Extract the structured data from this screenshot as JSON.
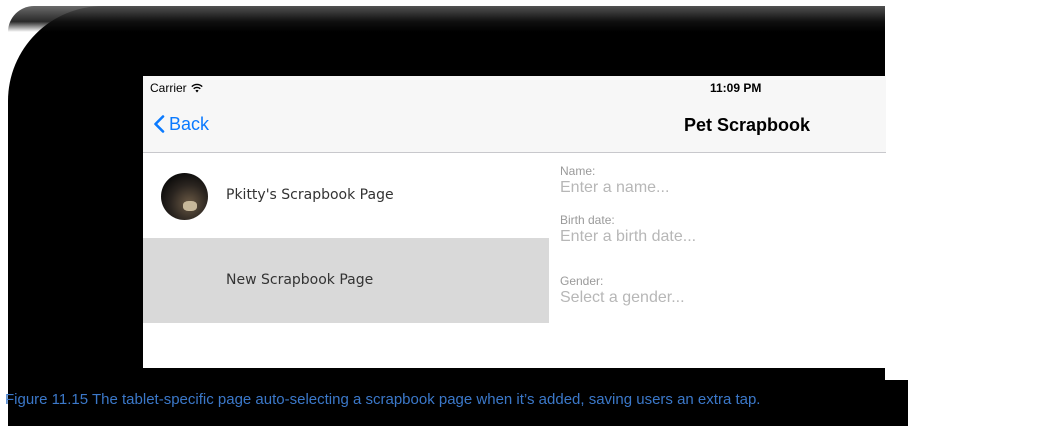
{
  "status_bar": {
    "carrier": "Carrier",
    "time": "11:09 PM"
  },
  "nav": {
    "back_label": "Back",
    "title": "Pet Scrapbook"
  },
  "pages": [
    {
      "label": "Pkitty's Scrapbook Page",
      "has_avatar": true,
      "selected": false
    },
    {
      "label": "New Scrapbook Page",
      "has_avatar": false,
      "selected": true
    }
  ],
  "detail": {
    "name_label": "Name:",
    "name_placeholder": "Enter a name...",
    "birth_label": "Birth date:",
    "birth_placeholder": "Enter a birth date...",
    "gender_label": "Gender:",
    "gender_placeholder": "Select a gender..."
  },
  "caption": "Figure 11.15 The tablet-specific page auto-selecting a scrapbook page when it’s added, saving users an extra tap.",
  "colors": {
    "accent": "#0a7aff",
    "caption": "#3b78c9",
    "selected_row": "#d9d9d9"
  }
}
